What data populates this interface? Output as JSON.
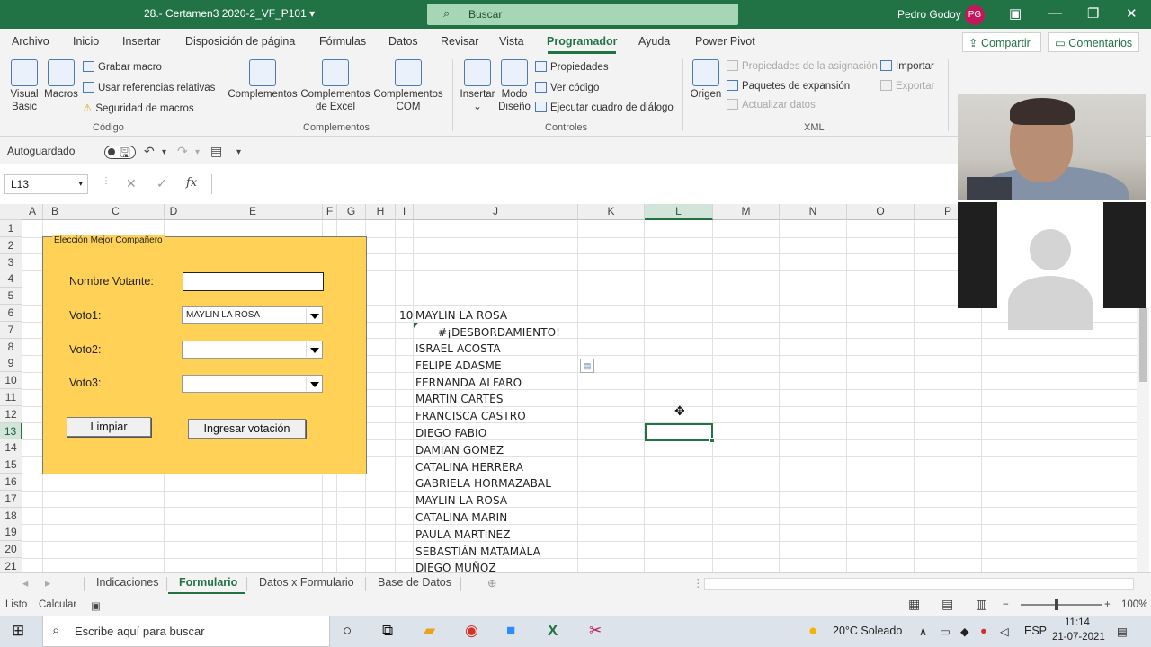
{
  "titlebar": {
    "doc_title": "28.- Certamen3 2020-2_VF_P101",
    "search_placeholder": "Buscar",
    "user_name": "Pedro Godoy",
    "user_initials": "PG"
  },
  "ribbon_tabs": [
    "Archivo",
    "Inicio",
    "Insertar",
    "Disposición de página",
    "Fórmulas",
    "Datos",
    "Revisar",
    "Vista",
    "Programador",
    "Ayuda",
    "Power Pivot"
  ],
  "active_tab": "Programador",
  "share_label": "Compartir",
  "comments_label": "Comentarios",
  "ribbon": {
    "codigo": {
      "label": "Código",
      "visual_basic": "Visual Basic",
      "macros": "Macros",
      "grabar": "Grabar macro",
      "referencias": "Usar referencias relativas",
      "seguridad": "Seguridad de macros"
    },
    "complementos": {
      "label": "Complementos",
      "complementos": "Complementos",
      "excel_1": "Complementos",
      "excel_2": "de Excel",
      "com_1": "Complementos",
      "com_2": "COM"
    },
    "controles": {
      "label": "Controles",
      "insertar": "Insertar",
      "modo_1": "Modo",
      "modo_2": "Diseño",
      "propiedades": "Propiedades",
      "ver_codigo": "Ver código",
      "ejecutar": "Ejecutar cuadro de diálogo"
    },
    "xml": {
      "label": "XML",
      "origen": "Origen",
      "prop_asignacion": "Propiedades de la asignación",
      "paquetes": "Paquetes de expansión",
      "actualizar": "Actualizar datos",
      "importar": "Importar",
      "exportar": "Exportar"
    }
  },
  "qat": {
    "autosave": "Autoguardado"
  },
  "formula_bar": {
    "name_box": "L13",
    "formula": ""
  },
  "columns": [
    "A",
    "B",
    "C",
    "D",
    "E",
    "F",
    "G",
    "H",
    "I",
    "J",
    "K",
    "L",
    "M",
    "N",
    "O",
    "P"
  ],
  "rows": [
    "1",
    "2",
    "3",
    "4",
    "5",
    "6",
    "7",
    "8",
    "9",
    "10",
    "11",
    "12",
    "13",
    "14",
    "15",
    "16",
    "17",
    "18",
    "19",
    "20",
    "21"
  ],
  "cells": {
    "i6": "10",
    "j6": "MAYLIN  LA ROSA",
    "j7": "#¡DESBORDAMIENTO!",
    "list": [
      "ISRAEL  ACOSTA",
      "FELIPE  ADASME",
      "FERNANDA  ALFARO",
      "MARTIN  CARTES",
      "FRANCISCA CASTRO",
      "DIEGO  FABIO",
      "DAMIAN  GOMEZ",
      "CATALINA  HERRERA",
      "GABRIELA  HORMAZABAL",
      "MAYLIN  LA ROSA",
      "CATALINA  MARIN",
      "PAULA  MARTINEZ",
      "SEBASTIÁN  MATAMALA",
      "DIEGO  MUÑOZ"
    ]
  },
  "form": {
    "title": "Elección Mejor Compañero",
    "nombre_label": "Nombre Votante:",
    "voto1_label": "Voto1:",
    "voto2_label": "Voto2:",
    "voto3_label": "Voto3:",
    "voto1_value": "MAYLIN  LA ROSA",
    "limpiar": "Limpiar",
    "ingresar": "Ingresar votación"
  },
  "sheets": [
    "Indicaciones",
    "Formulario",
    "Datos x Formulario",
    "Base de Datos"
  ],
  "active_sheet": "Formulario",
  "status": {
    "listo": "Listo",
    "calcular": "Calcular",
    "zoom": "100%"
  },
  "taskbar": {
    "search": "Escribe aquí para buscar",
    "weather": "20°C  Soleado",
    "lang": "ESP",
    "time": "11:14",
    "date": "21-07-2021"
  },
  "colors": {
    "excel_green": "#217346",
    "form_bg": "#ffd257"
  }
}
